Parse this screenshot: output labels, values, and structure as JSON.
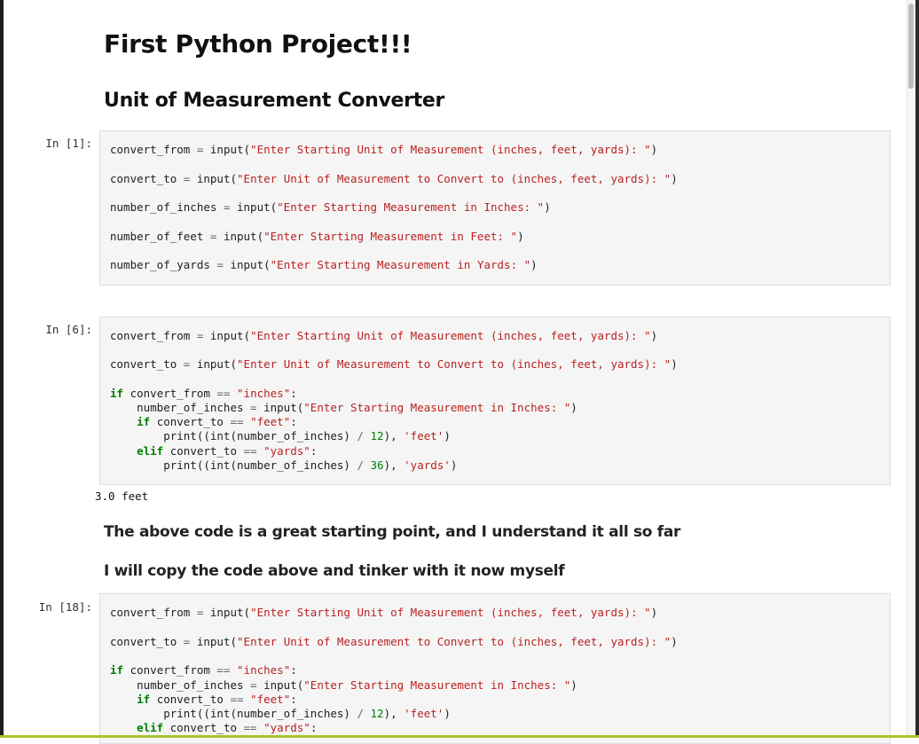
{
  "notebook": {
    "title": "First Python Project!!!",
    "subtitle": "Unit of Measurement Converter",
    "cells": [
      {
        "prompt": "In [1]:",
        "lines": [
          "convert_from = input(\"Enter Starting Unit of Measurement (inches, feet, yards): \")",
          "convert_to = input(\"Enter Unit of Measurement to Convert to (inches, feet, yards): \")",
          "number_of_inches = input(\"Enter Starting Measurement in Inches: \")",
          "number_of_feet = input(\"Enter Starting Measurement in Feet: \")",
          "number_of_yards = input(\"Enter Starting Measurement in Yards: \")"
        ]
      },
      {
        "prompt": "In [6]:",
        "lines": [
          "convert_from = input(\"Enter Starting Unit of Measurement (inches, feet, yards): \")",
          "convert_to = input(\"Enter Unit of Measurement to Convert to (inches, feet, yards): \")",
          "if convert_from == \"inches\":",
          "    number_of_inches = input(\"Enter Starting Measurement in Inches: \")",
          "    if convert_to == \"feet\":",
          "        print((int(number_of_inches) / 12), 'feet')",
          "    elif convert_to == \"yards\":",
          "        print((int(number_of_inches) / 36), 'yards')"
        ],
        "output": "3.0 feet"
      },
      {
        "prompt": "In [18]:",
        "lines": [
          "convert_from = input(\"Enter Starting Unit of Measurement (inches, feet, yards): \")",
          "convert_to = input(\"Enter Unit of Measurement to Convert to (inches, feet, yards): \")",
          "if convert_from == \"inches\":",
          "    number_of_inches = input(\"Enter Starting Measurement in Inches: \")",
          "    if convert_to == \"feet\":",
          "        print((int(number_of_inches) / 12), 'feet')",
          "    elif convert_to == \"yards\":"
        ]
      }
    ],
    "markdown": [
      "The above code is a great starting point, and I understand it all so far",
      "I will copy the code above and tinker with it now myself"
    ]
  }
}
